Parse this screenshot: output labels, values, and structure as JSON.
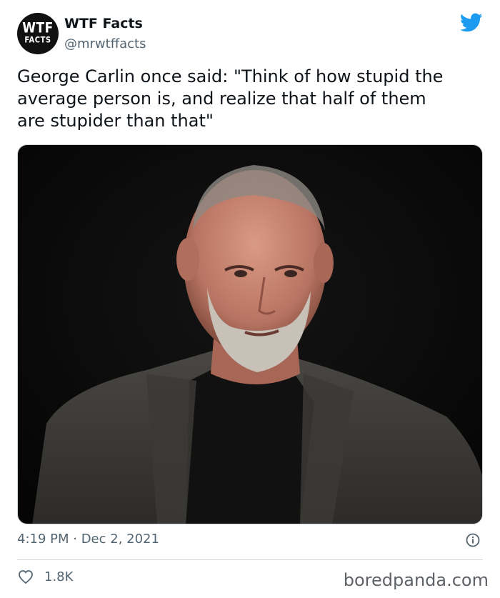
{
  "tweet": {
    "author_name": "WTF Facts",
    "author_handle": "@mrwtffacts",
    "avatar_text_top": "WTF",
    "avatar_text_bottom": "FACTS",
    "body": "George Carlin once said: \"Think of how stupid the\naverage person is, and realize that half of them\nare stupider than that\"",
    "timestamp": "4:19 PM · Dec 2, 2021",
    "like_count": "1.8K",
    "icons": [
      "twitter-bird-icon",
      "info-icon",
      "heart-icon"
    ],
    "accent_color": "#1d9bf0"
  },
  "watermark": "boredpanda.com"
}
